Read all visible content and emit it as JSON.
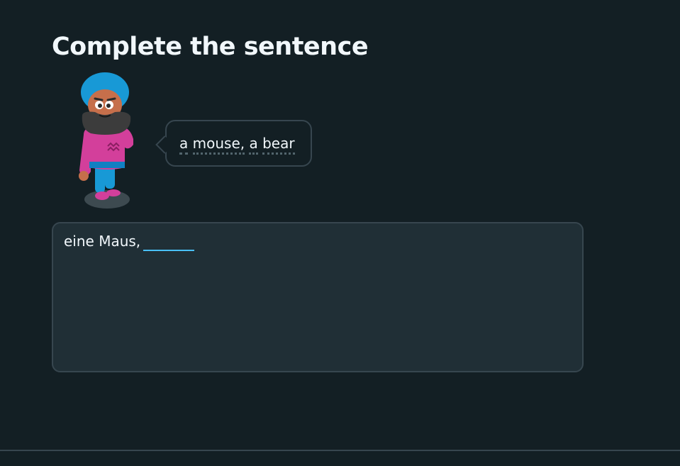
{
  "header": {
    "title": "Complete the sentence"
  },
  "character": {
    "name": "character-avatar"
  },
  "speech_bubble": {
    "words": [
      "a",
      "mouse,",
      "a",
      "bear"
    ]
  },
  "exercise": {
    "prompt_text": "eine Maus,",
    "answer_value": "",
    "answer_placeholder": ""
  },
  "colors": {
    "background": "#131f24",
    "panel": "#202f36",
    "border": "#37464f",
    "accent": "#49c0f8"
  }
}
